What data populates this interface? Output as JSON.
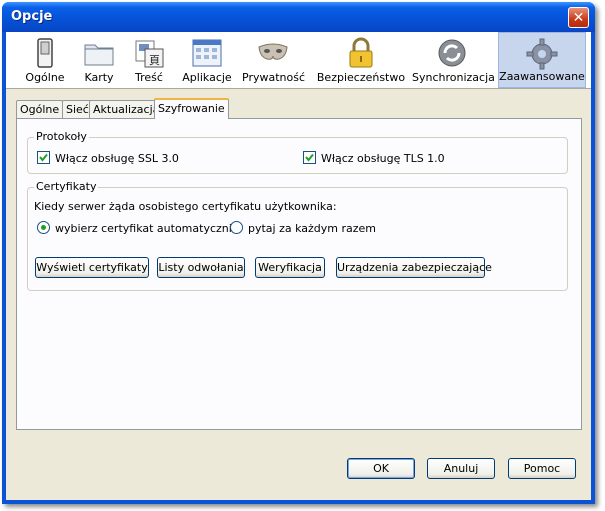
{
  "window": {
    "title": "Opcje",
    "close_label": "✕"
  },
  "toolbar": {
    "items": [
      {
        "label": "Ogólne",
        "icon": "general-switch-icon"
      },
      {
        "label": "Karty",
        "icon": "tabs-folder-icon"
      },
      {
        "label": "Treść",
        "icon": "content-icon"
      },
      {
        "label": "Aplikacje",
        "icon": "applications-icon"
      },
      {
        "label": "Prywatność",
        "icon": "mask-icon"
      },
      {
        "label": "Bezpieczeństwo",
        "icon": "padlock-icon"
      },
      {
        "label": "Synchronizacja",
        "icon": "sync-icon"
      },
      {
        "label": "Zaawansowane",
        "icon": "gear-icon"
      }
    ],
    "selected": "Zaawansowane"
  },
  "tabs": {
    "items": [
      "Ogólne",
      "Sieć",
      "Aktualizacja",
      "Szyfrowanie"
    ],
    "active": "Szyfrowanie"
  },
  "protocols": {
    "title": "Protokoły",
    "ssl_label": "Włącz obsługę SSL 3.0",
    "ssl_checked": true,
    "tls_label": "Włącz obsługę TLS 1.0",
    "tls_checked": true
  },
  "certificates": {
    "title": "Certyfikaty",
    "prompt": "Kiedy serwer żąda osobistego certyfikatu użytkownika:",
    "radio_auto": "wybierz certyfikat automatycznie",
    "radio_ask": "pytaj za każdym razem",
    "selected": "auto",
    "buttons": {
      "view": "Wyświetl certyfikaty",
      "revocation": "Listy odwołania",
      "validation": "Weryfikacja",
      "devices": "Urządzenia zabezpieczające"
    }
  },
  "footer": {
    "ok": "OK",
    "cancel": "Anuluj",
    "help": "Pomoc"
  },
  "colors": {
    "titlebar": "#0553d9",
    "selected_toolbar": "#c7d6ec",
    "active_tab_accent": "#f2b441"
  }
}
